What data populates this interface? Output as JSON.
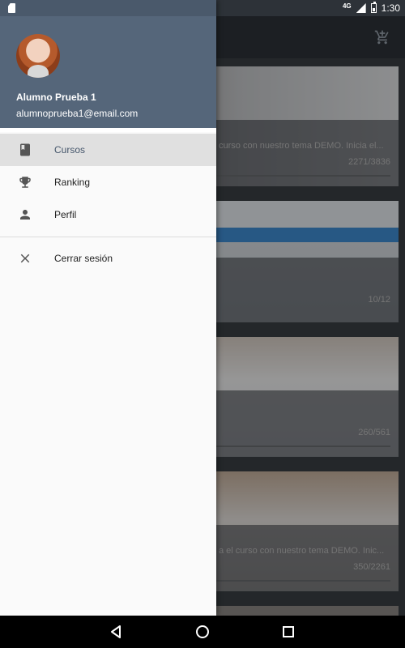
{
  "status_bar": {
    "time": "1:30",
    "network": "4G"
  },
  "courses": [
    {
      "description": "curso con nuestro tema DEMO. Inicia el...",
      "progress_text": "2271/3836",
      "progress": 0.06
    },
    {
      "description": "",
      "progress_text": "10/12",
      "progress": 0
    },
    {
      "description": "",
      "progress_text": "260/561",
      "progress": 0
    },
    {
      "description": "a el curso con nuestro tema DEMO. Inic...",
      "progress_text": "350/2261",
      "progress": 0
    }
  ],
  "drawer": {
    "user": {
      "name": "Alumno Prueba 1",
      "email": "alumnoprueba1@email.com"
    },
    "menu": [
      {
        "label": "Cursos",
        "icon": "book-icon",
        "active": true
      },
      {
        "label": "Ranking",
        "icon": "trophy-icon",
        "active": false
      },
      {
        "label": "Perfil",
        "icon": "person-icon",
        "active": false
      }
    ],
    "logout_label": "Cerrar sesión"
  },
  "colors": {
    "header": "#55667a",
    "active_item": "#e0e0e0",
    "active_text": "#45566b"
  }
}
